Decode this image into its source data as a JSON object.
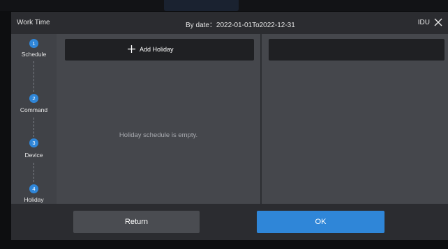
{
  "dialog": {
    "title": "Work Time",
    "date_range": "By date：2022-01-01To2022-12-31",
    "unit": "IDU"
  },
  "steps": [
    {
      "number": "1",
      "label": "Schedule"
    },
    {
      "number": "2",
      "label": "Command"
    },
    {
      "number": "3",
      "label": "Device"
    },
    {
      "number": "4",
      "label": "Holiday\n(Options)"
    }
  ],
  "holiday_panel": {
    "add_label": "Add Holiday",
    "empty_text": "Holiday schedule is empty."
  },
  "footer": {
    "return_label": "Return",
    "ok_label": "OK"
  },
  "colors": {
    "accent": "#2f86d8",
    "panel": "#45474c",
    "dark_field": "#1f2023"
  },
  "icons": {
    "close": "close-icon",
    "add": "plus-icon"
  }
}
